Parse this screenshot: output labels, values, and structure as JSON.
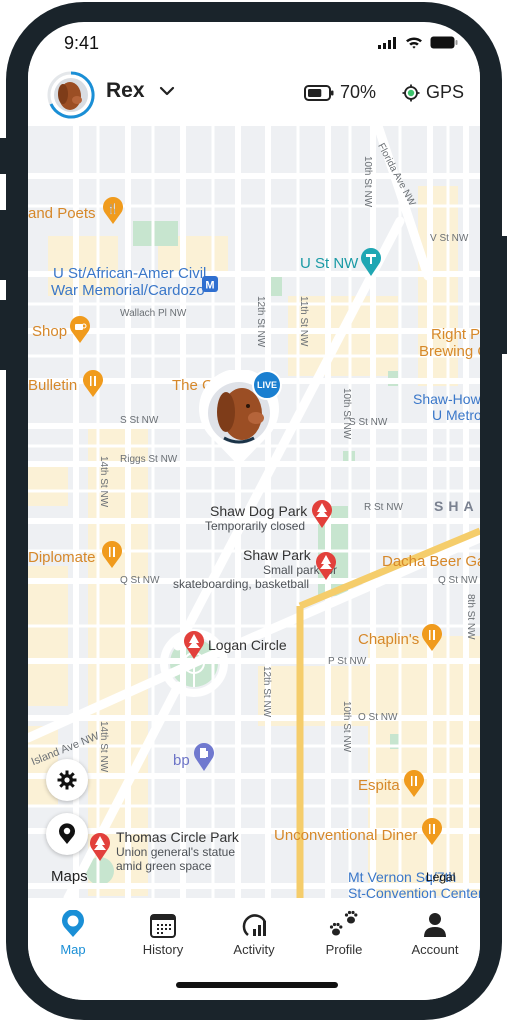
{
  "status_bar": {
    "time": "9:41"
  },
  "header": {
    "pet_name": "Rex",
    "battery_percent": "70%",
    "battery_level": 0.7,
    "gps_label": "GPS",
    "gps_status_color": "#3ec46d",
    "accent_color": "#1a8fd6"
  },
  "map": {
    "live_badge": "LIVE",
    "streets": [
      "Florida Ave NW",
      "V St NW",
      "10th St NW",
      "12th St NW",
      "11th St NW",
      "Wallach Pl NW",
      "S St NW",
      "Riggs St NW",
      "14th St NW",
      "R St NW",
      "Q St NW",
      "P St NW",
      "O St NW",
      "8th St NW",
      "Island Ave NW"
    ],
    "street_labels": {
      "florida": "Florida Ave NW",
      "v_st": "V St NW",
      "tenth_top": "10th St NW",
      "twelfth_top": "12th St NW",
      "eleventh_top": "11th St NW",
      "wallach": "Wallach Pl NW",
      "s_st_left": "S St NW",
      "s_st_right": "S St NW",
      "riggs": "Riggs St NW",
      "fourteenth": "14th St NW",
      "fourteenth_lower": "14th St NW",
      "tenth_mid": "10th St NW",
      "r_st": "R St NW",
      "q_st_left": "Q St NW",
      "q_st_right": "Q St NW",
      "p_st": "P St NW",
      "o_st": "O St NW",
      "tenth_low": "10th St NW",
      "twelfth_low": "12th St NW",
      "eighth": "8th St NW",
      "island": "Island Ave NW"
    },
    "pois": {
      "poets": "and Poets",
      "u_st_metro_1": "U St/African-Amer Civil",
      "u_st_metro_2": "War Memorial/Cardozo",
      "u_st_nw": "U St NW",
      "shop": "Shop",
      "bulletin": "Bulletin",
      "the": "The C",
      "right_proper_1": "Right P",
      "right_proper_2": "Brewing Com",
      "shaw_metro_1": "Shaw-How",
      "shaw_metro_2": "U Metro",
      "shaw_area": "SHA",
      "shaw_dog_park": "Shaw Dog Park",
      "shaw_dog_park_sub": "Temporarily closed",
      "shaw_park": "Shaw Park",
      "shaw_park_sub_1": "Small park for",
      "shaw_park_sub_2": "skateboarding, basketball",
      "diplomate": "Diplomate",
      "dacha": "Dacha Beer Garden",
      "chaplins": "Chaplin's",
      "logan_circle": "Logan Circle",
      "bp": "bp",
      "espita": "Espita",
      "unconventional": "Unconventional Diner",
      "thomas_circle": "Thomas Circle Park",
      "thomas_sub_1": "Union general's statue",
      "thomas_sub_2": "amid green space",
      "mt_vernon_1": "Mt Vernon Sq/7th",
      "mt_vernon_2": "St-Convention Center",
      "legal": "Legal",
      "maps_logo": "Maps"
    }
  },
  "tabs": [
    {
      "label": "Map",
      "icon": "map-pin-icon",
      "active": true
    },
    {
      "label": "History",
      "icon": "calendar-icon",
      "active": false
    },
    {
      "label": "Activity",
      "icon": "activity-chart-icon",
      "active": false
    },
    {
      "label": "Profile",
      "icon": "paws-icon",
      "active": false
    },
    {
      "label": "Account",
      "icon": "person-icon",
      "active": false
    }
  ]
}
